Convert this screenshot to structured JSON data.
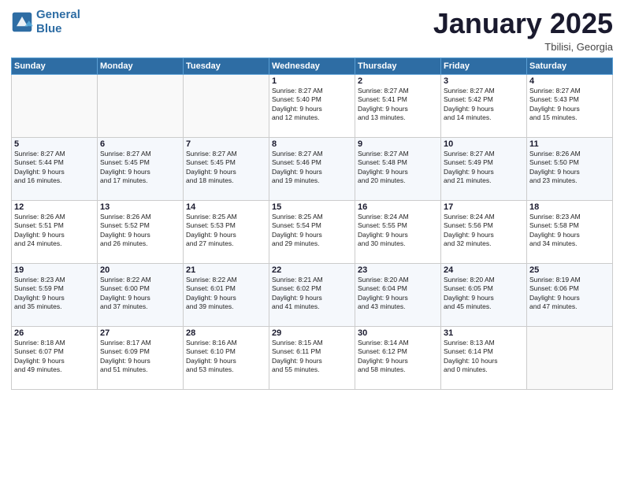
{
  "logo": {
    "line1": "General",
    "line2": "Blue"
  },
  "header": {
    "month": "January 2025",
    "location": "Tbilisi, Georgia"
  },
  "days_of_week": [
    "Sunday",
    "Monday",
    "Tuesday",
    "Wednesday",
    "Thursday",
    "Friday",
    "Saturday"
  ],
  "weeks": [
    [
      {
        "num": "",
        "info": ""
      },
      {
        "num": "",
        "info": ""
      },
      {
        "num": "",
        "info": ""
      },
      {
        "num": "1",
        "info": "Sunrise: 8:27 AM\nSunset: 5:40 PM\nDaylight: 9 hours\nand 12 minutes."
      },
      {
        "num": "2",
        "info": "Sunrise: 8:27 AM\nSunset: 5:41 PM\nDaylight: 9 hours\nand 13 minutes."
      },
      {
        "num": "3",
        "info": "Sunrise: 8:27 AM\nSunset: 5:42 PM\nDaylight: 9 hours\nand 14 minutes."
      },
      {
        "num": "4",
        "info": "Sunrise: 8:27 AM\nSunset: 5:43 PM\nDaylight: 9 hours\nand 15 minutes."
      }
    ],
    [
      {
        "num": "5",
        "info": "Sunrise: 8:27 AM\nSunset: 5:44 PM\nDaylight: 9 hours\nand 16 minutes."
      },
      {
        "num": "6",
        "info": "Sunrise: 8:27 AM\nSunset: 5:45 PM\nDaylight: 9 hours\nand 17 minutes."
      },
      {
        "num": "7",
        "info": "Sunrise: 8:27 AM\nSunset: 5:45 PM\nDaylight: 9 hours\nand 18 minutes."
      },
      {
        "num": "8",
        "info": "Sunrise: 8:27 AM\nSunset: 5:46 PM\nDaylight: 9 hours\nand 19 minutes."
      },
      {
        "num": "9",
        "info": "Sunrise: 8:27 AM\nSunset: 5:48 PM\nDaylight: 9 hours\nand 20 minutes."
      },
      {
        "num": "10",
        "info": "Sunrise: 8:27 AM\nSunset: 5:49 PM\nDaylight: 9 hours\nand 21 minutes."
      },
      {
        "num": "11",
        "info": "Sunrise: 8:26 AM\nSunset: 5:50 PM\nDaylight: 9 hours\nand 23 minutes."
      }
    ],
    [
      {
        "num": "12",
        "info": "Sunrise: 8:26 AM\nSunset: 5:51 PM\nDaylight: 9 hours\nand 24 minutes."
      },
      {
        "num": "13",
        "info": "Sunrise: 8:26 AM\nSunset: 5:52 PM\nDaylight: 9 hours\nand 26 minutes."
      },
      {
        "num": "14",
        "info": "Sunrise: 8:25 AM\nSunset: 5:53 PM\nDaylight: 9 hours\nand 27 minutes."
      },
      {
        "num": "15",
        "info": "Sunrise: 8:25 AM\nSunset: 5:54 PM\nDaylight: 9 hours\nand 29 minutes."
      },
      {
        "num": "16",
        "info": "Sunrise: 8:24 AM\nSunset: 5:55 PM\nDaylight: 9 hours\nand 30 minutes."
      },
      {
        "num": "17",
        "info": "Sunrise: 8:24 AM\nSunset: 5:56 PM\nDaylight: 9 hours\nand 32 minutes."
      },
      {
        "num": "18",
        "info": "Sunrise: 8:23 AM\nSunset: 5:58 PM\nDaylight: 9 hours\nand 34 minutes."
      }
    ],
    [
      {
        "num": "19",
        "info": "Sunrise: 8:23 AM\nSunset: 5:59 PM\nDaylight: 9 hours\nand 35 minutes."
      },
      {
        "num": "20",
        "info": "Sunrise: 8:22 AM\nSunset: 6:00 PM\nDaylight: 9 hours\nand 37 minutes."
      },
      {
        "num": "21",
        "info": "Sunrise: 8:22 AM\nSunset: 6:01 PM\nDaylight: 9 hours\nand 39 minutes."
      },
      {
        "num": "22",
        "info": "Sunrise: 8:21 AM\nSunset: 6:02 PM\nDaylight: 9 hours\nand 41 minutes."
      },
      {
        "num": "23",
        "info": "Sunrise: 8:20 AM\nSunset: 6:04 PM\nDaylight: 9 hours\nand 43 minutes."
      },
      {
        "num": "24",
        "info": "Sunrise: 8:20 AM\nSunset: 6:05 PM\nDaylight: 9 hours\nand 45 minutes."
      },
      {
        "num": "25",
        "info": "Sunrise: 8:19 AM\nSunset: 6:06 PM\nDaylight: 9 hours\nand 47 minutes."
      }
    ],
    [
      {
        "num": "26",
        "info": "Sunrise: 8:18 AM\nSunset: 6:07 PM\nDaylight: 9 hours\nand 49 minutes."
      },
      {
        "num": "27",
        "info": "Sunrise: 8:17 AM\nSunset: 6:09 PM\nDaylight: 9 hours\nand 51 minutes."
      },
      {
        "num": "28",
        "info": "Sunrise: 8:16 AM\nSunset: 6:10 PM\nDaylight: 9 hours\nand 53 minutes."
      },
      {
        "num": "29",
        "info": "Sunrise: 8:15 AM\nSunset: 6:11 PM\nDaylight: 9 hours\nand 55 minutes."
      },
      {
        "num": "30",
        "info": "Sunrise: 8:14 AM\nSunset: 6:12 PM\nDaylight: 9 hours\nand 58 minutes."
      },
      {
        "num": "31",
        "info": "Sunrise: 8:13 AM\nSunset: 6:14 PM\nDaylight: 10 hours\nand 0 minutes."
      },
      {
        "num": "",
        "info": ""
      }
    ]
  ]
}
